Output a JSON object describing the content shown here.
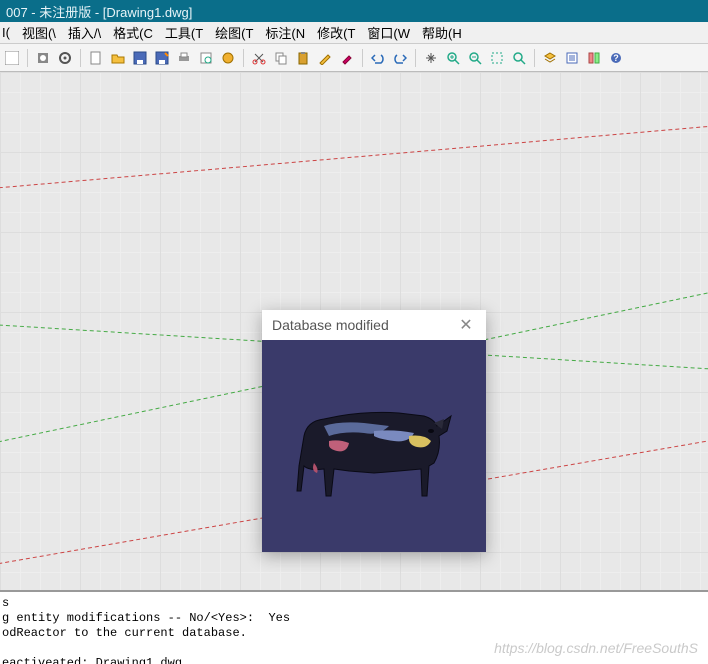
{
  "titlebar": {
    "text": "007 - 未注册版 - [Drawing1.dwg]"
  },
  "menu": {
    "items": [
      "I(",
      "视图(\\",
      "插入/\\",
      "格式(C",
      "工具(T",
      "绘图(T",
      "标注(N",
      "修改(T",
      "窗口(W",
      "帮助(H"
    ]
  },
  "popup": {
    "title": "Database modified"
  },
  "cmd": {
    "lines": [
      "s",
      "g entity modifications -- No/<Yes>:  Yes",
      "odReactor to the current database.",
      "",
      "eactiveated: Drawing1.dwg."
    ]
  },
  "watermark": "https://blog.csdn.net/FreeSouthS"
}
